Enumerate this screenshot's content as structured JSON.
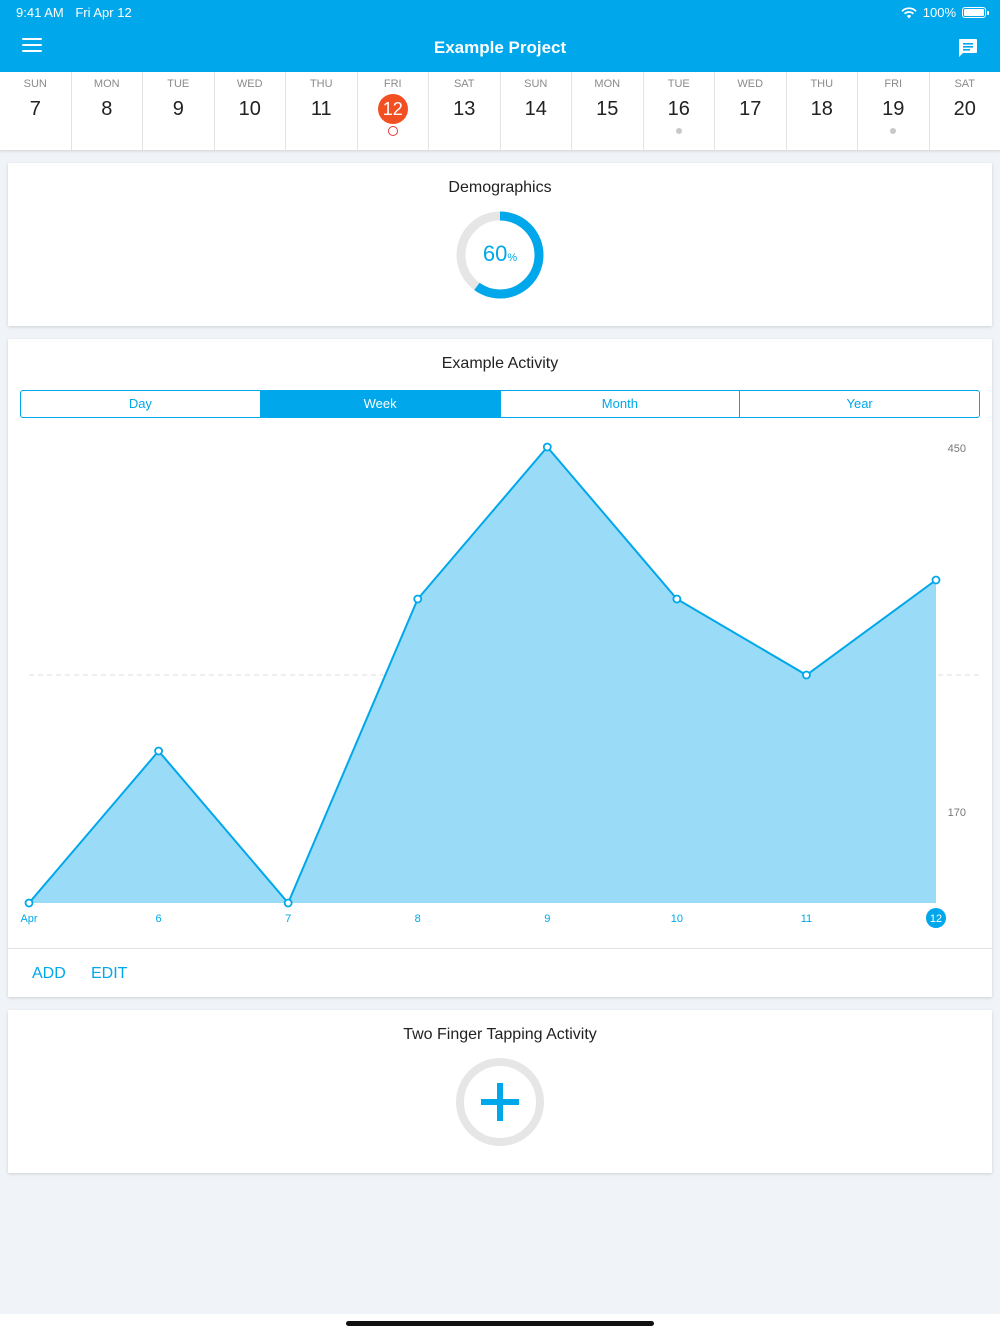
{
  "status": {
    "time": "9:41 AM",
    "date": "Fri Apr 12",
    "battery": "100%",
    "battery_level": 1.0
  },
  "nav": {
    "title": "Example Project",
    "menu_icon": "hamburger-menu-icon",
    "chat_icon": "chat-bubble-icon"
  },
  "week": [
    {
      "name": "SUN",
      "num": "7",
      "today": false,
      "dot": false
    },
    {
      "name": "MON",
      "num": "8",
      "today": false,
      "dot": false
    },
    {
      "name": "TUE",
      "num": "9",
      "today": false,
      "dot": false
    },
    {
      "name": "WED",
      "num": "10",
      "today": false,
      "dot": false
    },
    {
      "name": "THU",
      "num": "11",
      "today": false,
      "dot": false
    },
    {
      "name": "FRI",
      "num": "12",
      "today": true,
      "dot": false
    },
    {
      "name": "SAT",
      "num": "13",
      "today": false,
      "dot": false
    },
    {
      "name": "SUN",
      "num": "14",
      "today": false,
      "dot": false
    },
    {
      "name": "MON",
      "num": "15",
      "today": false,
      "dot": false
    },
    {
      "name": "TUE",
      "num": "16",
      "today": false,
      "dot": true
    },
    {
      "name": "WED",
      "num": "17",
      "today": false,
      "dot": false
    },
    {
      "name": "THU",
      "num": "18",
      "today": false,
      "dot": false
    },
    {
      "name": "FRI",
      "num": "19",
      "today": false,
      "dot": true
    },
    {
      "name": "SAT",
      "num": "20",
      "today": false,
      "dot": false
    }
  ],
  "demographics": {
    "title": "Demographics",
    "percent": 60,
    "value_label": "60",
    "unit_label": "%"
  },
  "activity": {
    "title": "Example Activity",
    "tabs": [
      "Day",
      "Week",
      "Month",
      "Year"
    ],
    "active_tab": "Week",
    "add_label": "ADD",
    "edit_label": "EDIT"
  },
  "tapping": {
    "title": "Two Finger Tapping Activity",
    "add_icon": "plus-icon"
  },
  "colors": {
    "accent": "#00a7ea",
    "today": "#f25022",
    "area_fill": "#9adcf7",
    "ring_track": "#e6e6e6"
  },
  "chart_data": {
    "type": "area",
    "x": [
      "Apr",
      "6",
      "7",
      "8",
      "9",
      "10",
      "11",
      "12"
    ],
    "values": [
      50,
      130,
      50,
      210,
      290,
      210,
      170,
      220
    ],
    "highlight_x": "12",
    "y_tick_labels": [
      "450",
      "170"
    ],
    "reference_line": "dashed",
    "ylim": [
      50,
      290
    ]
  }
}
